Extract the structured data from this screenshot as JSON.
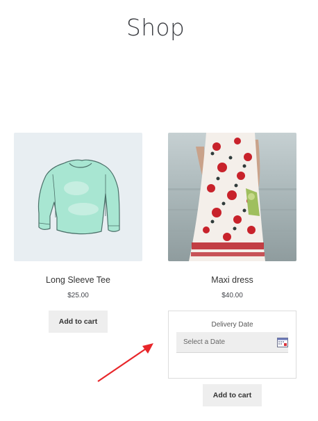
{
  "page": {
    "title": "Shop"
  },
  "products": [
    {
      "name": "Long Sleeve Tee",
      "price": "$25.00",
      "button_label": "Add to cart",
      "image": "long-sleeve-tee-image"
    },
    {
      "name": "Maxi dress",
      "price": "$40.00",
      "button_label": "Add to cart",
      "image": "maxi-dress-image"
    }
  ],
  "delivery": {
    "label": "Delivery Date",
    "placeholder": "Select a Date",
    "icon": "calendar-icon"
  },
  "annotation": {
    "icon": "red-arrow-icon",
    "color": "#e8262a"
  },
  "colors": {
    "button_bg": "#eeeeee",
    "tee_bg": "#e8eef2",
    "tee_fill": "#a8e6d2"
  }
}
